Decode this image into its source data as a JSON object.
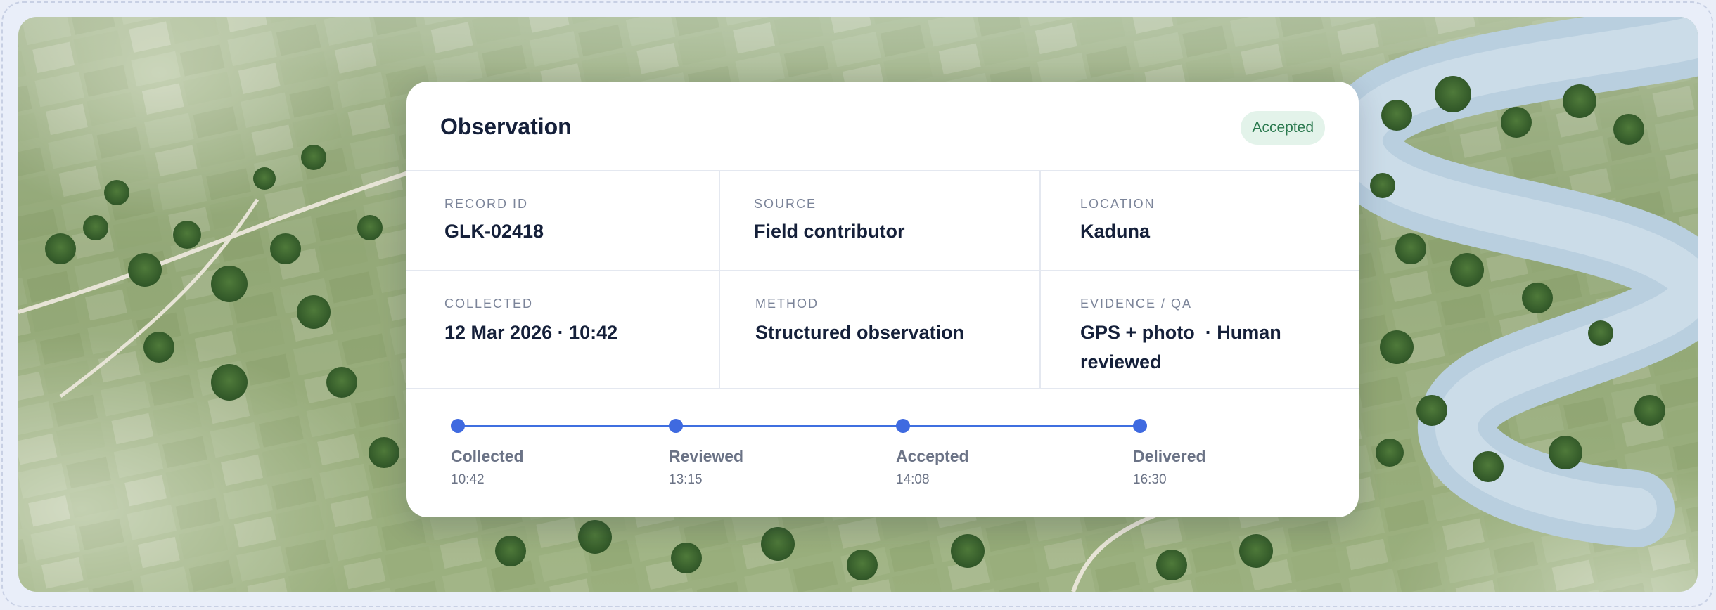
{
  "card": {
    "title": "Observation",
    "status": "Accepted"
  },
  "fields": {
    "record_id": {
      "label": "RECORD ID",
      "value": "GLK-02418"
    },
    "source": {
      "label": "SOURCE",
      "value": "Field contributor"
    },
    "location": {
      "label": "LOCATION",
      "value": "Kaduna"
    },
    "collected": {
      "label": "COLLECTED",
      "value": "12 Mar 2026 · 10:42"
    },
    "method": {
      "label": "METHOD",
      "value": "Structured observation"
    },
    "evidence": {
      "label": "EVIDENCE / QA",
      "value_line1": "GPS + photo  · Human",
      "value_line2": "reviewed"
    }
  },
  "timeline": [
    {
      "label": "Collected",
      "time": "10:42"
    },
    {
      "label": "Reviewed",
      "time": "13:15"
    },
    {
      "label": "Accepted",
      "time": "14:08"
    },
    {
      "label": "Delivered",
      "time": "16:30"
    }
  ],
  "colors": {
    "accent": "#3f6ae0",
    "badge_bg": "#e3f3ea",
    "badge_text": "#2b7a4f",
    "title_text": "#15203a"
  }
}
